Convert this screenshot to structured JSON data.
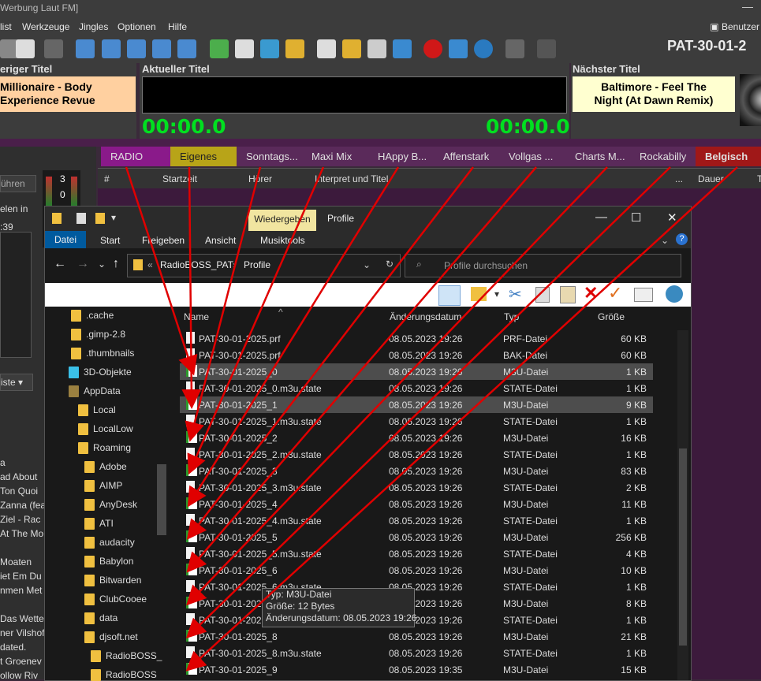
{
  "app": {
    "title": "Werbung Laut FM]",
    "menu": [
      "list",
      "Werkzeuge",
      "Jingles",
      "Optionen",
      "Hilfe"
    ],
    "user_label": "Benutzer",
    "station": "PAT-30-01-2",
    "previous": {
      "label": "eriger Titel",
      "line1": "Millionaire - Body",
      "line2": "Experience Revue"
    },
    "current": {
      "label": "Aktueller Titel",
      "time_left": "00:00.0",
      "time_right": "00:00.0"
    },
    "next": {
      "label": "Nächster Titel",
      "line1": "Baltimore - Feel The",
      "line2": "Night (At Dawn Remix)"
    },
    "left_panel": {
      "button": "ühren",
      "label": "elen in",
      "time": ":39",
      "dropdown": "iste",
      "meter_top": "3",
      "meter_bottom": "0",
      "history": [
        "a",
        "ad About",
        "Ton Quoi",
        "Zanna (fea",
        "Ziel - Rac",
        "At The Mo",
        "",
        "Moaten",
        "iet Em Du",
        "nmen Met",
        "",
        "Das Wette",
        "ner Vilshof",
        "dated.",
        "t Groenev",
        "ollow Riv"
      ]
    },
    "tabs": [
      {
        "label": "RADIO",
        "color": "#8a1a8a"
      },
      {
        "label": "Eigenes",
        "color": "#b8a418",
        "text": "#222"
      },
      {
        "label": "Sonntags...",
        "color": "#5a2a5a"
      },
      {
        "label": "Maxi Mix",
        "color": "#5a2a5a"
      },
      {
        "label": "HAppy B...",
        "color": "#5a2a5a"
      },
      {
        "label": "Affenstark",
        "color": "#5a2a5a"
      },
      {
        "label": "Vollgas ...",
        "color": "#5a2a5a"
      },
      {
        "label": "Charts M...",
        "color": "#5a2a5a"
      },
      {
        "label": "Rockabilly",
        "color": "#5a2a5a"
      },
      {
        "label": "Belgisch",
        "color": "#a01818",
        "bold": true
      }
    ],
    "columns": [
      "#",
      "Startzeit",
      "Hörer",
      "Interpret und Titel",
      "...",
      "Dauer",
      "Ti"
    ]
  },
  "explorer": {
    "context_tab": "Wiedergeben",
    "title": "Profile",
    "ribbon": [
      "Datei",
      "Start",
      "Freigeben",
      "Ansicht",
      "Musiktools"
    ],
    "breadcrumb": [
      "«",
      "RadioBOSS_PAT",
      "›",
      "Profile"
    ],
    "search_placeholder": "Profile durchsuchen",
    "nav": [
      {
        "label": ".cache",
        "indent": 1
      },
      {
        "label": ".gimp-2.8",
        "indent": 1
      },
      {
        "label": ".thumbnails",
        "indent": 1
      },
      {
        "label": "3D-Objekte",
        "indent": 0,
        "icon": "cube"
      },
      {
        "label": "AppData",
        "indent": 0,
        "dark": true
      },
      {
        "label": "Local",
        "indent": 2
      },
      {
        "label": "LocalLow",
        "indent": 2
      },
      {
        "label": "Roaming",
        "indent": 2
      },
      {
        "label": "Adobe",
        "indent": 3
      },
      {
        "label": "AIMP",
        "indent": 3
      },
      {
        "label": "AnyDesk",
        "indent": 3
      },
      {
        "label": "ATI",
        "indent": 3
      },
      {
        "label": "audacity",
        "indent": 3
      },
      {
        "label": "Babylon",
        "indent": 3
      },
      {
        "label": "Bitwarden",
        "indent": 3
      },
      {
        "label": "ClubCooee",
        "indent": 3
      },
      {
        "label": "data",
        "indent": 3
      },
      {
        "label": "djsoft.net",
        "indent": 3
      },
      {
        "label": "RadioBOSS_",
        "indent": 4
      },
      {
        "label": "RadioBOSS",
        "indent": 4
      }
    ],
    "columns": [
      "Name",
      "Änderungsdatum",
      "Typ",
      "Größe"
    ],
    "files": [
      {
        "name": "PAT-30-01-2025.prf",
        "date": "08.05.2023 19:26",
        "type": "PRF-Datei",
        "size": "60 KB",
        "icon": "doc"
      },
      {
        "name": "PAT-30-01-2025.prf",
        "date": "08.05.2023 19:26",
        "type": "BAK-Datei",
        "size": "60 KB",
        "icon": "doc"
      },
      {
        "name": "PAT-30-01-2025_0",
        "date": "08.05.2023 19:26",
        "type": "M3U-Datei",
        "size": "1 KB",
        "icon": "m3u",
        "selected": true
      },
      {
        "name": "PAT-30-01-2025_0.m3u.state",
        "date": "08.05.2023 19:26",
        "type": "STATE-Datei",
        "size": "1 KB",
        "icon": "doc"
      },
      {
        "name": "PAT-30-01-2025_1",
        "date": "08.05.2023 19:26",
        "type": "M3U-Datei",
        "size": "9 KB",
        "icon": "m3u",
        "selected": true
      },
      {
        "name": "PAT-30-01-2025_1.m3u.state",
        "date": "08.05.2023 19:26",
        "type": "STATE-Datei",
        "size": "1 KB",
        "icon": "doc"
      },
      {
        "name": "PAT-30-01-2025_2",
        "date": "08.05.2023 19:26",
        "type": "M3U-Datei",
        "size": "16 KB",
        "icon": "m3u"
      },
      {
        "name": "PAT-30-01-2025_2.m3u.state",
        "date": "08.05.2023 19:26",
        "type": "STATE-Datei",
        "size": "1 KB",
        "icon": "doc"
      },
      {
        "name": "PAT-30-01-2025_3",
        "date": "08.05.2023 19:26",
        "type": "M3U-Datei",
        "size": "83 KB",
        "icon": "m3u"
      },
      {
        "name": "PAT-30-01-2025_3.m3u.state",
        "date": "08.05.2023 19:26",
        "type": "STATE-Datei",
        "size": "2 KB",
        "icon": "doc"
      },
      {
        "name": "PAT-30-01-2025_4",
        "date": "08.05.2023 19:26",
        "type": "M3U-Datei",
        "size": "11 KB",
        "icon": "m3u"
      },
      {
        "name": "PAT-30-01-2025_4.m3u.state",
        "date": "08.05.2023 19:26",
        "type": "STATE-Datei",
        "size": "1 KB",
        "icon": "doc"
      },
      {
        "name": "PAT-30-01-2025_5",
        "date": "08.05.2023 19:26",
        "type": "M3U-Datei",
        "size": "256 KB",
        "icon": "m3u"
      },
      {
        "name": "PAT-30-01-2025_5.m3u.state",
        "date": "08.05.2023 19:26",
        "type": "STATE-Datei",
        "size": "4 KB",
        "icon": "doc"
      },
      {
        "name": "PAT-30-01-2025_6",
        "date": "08.05.2023 19:26",
        "type": "M3U-Datei",
        "size": "10 KB",
        "icon": "m3u"
      },
      {
        "name": "PAT-30-01-2025_6.m3u.state",
        "date": "08.05.2023 19:26",
        "type": "STATE-Datei",
        "size": "1 KB",
        "icon": "doc"
      },
      {
        "name": "PAT-30-01-2025_7",
        "date": "08.05.2023 19:26",
        "type": "M3U-Datei",
        "size": "8 KB",
        "icon": "m3u"
      },
      {
        "name": "PAT-30-01-2025_7.m3u.state",
        "date": "08.05.2023 19:26",
        "type": "STATE-Datei",
        "size": "1 KB",
        "icon": "doc"
      },
      {
        "name": "PAT-30-01-2025_8",
        "date": "08.05.2023 19:26",
        "type": "M3U-Datei",
        "size": "21 KB",
        "icon": "m3u"
      },
      {
        "name": "PAT-30-01-2025_8.m3u.state",
        "date": "08.05.2023 19:26",
        "type": "STATE-Datei",
        "size": "1 KB",
        "icon": "doc"
      },
      {
        "name": "PAT-30-01-2025_9",
        "date": "08.05.2023 19:35",
        "type": "M3U-Datei",
        "size": "15 KB",
        "icon": "m3u"
      }
    ],
    "tooltip": [
      "Typ: M3U-Datei",
      "Größe: 12 Bytes",
      "Änderungsdatum: 08.05.2023 19:26"
    ],
    "annotation_color": "#e00000"
  }
}
